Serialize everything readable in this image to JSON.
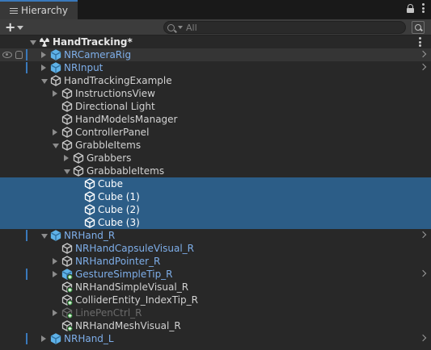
{
  "tab": {
    "title": "Hierarchy"
  },
  "search": {
    "placeholder": "All"
  },
  "rows": [
    {
      "name": "HandTracking*",
      "kind": "scene",
      "depth": 0,
      "fold": "down"
    },
    {
      "name": "NRCameraRig",
      "kind": "prefab",
      "depth": 1,
      "fold": "right",
      "style": "blue",
      "chevron": true,
      "modified": true,
      "hovered": true,
      "tools": true
    },
    {
      "name": "NRInput",
      "kind": "prefab",
      "depth": 1,
      "fold": "right",
      "style": "blue",
      "chevron": true,
      "modified": true
    },
    {
      "name": "HandTrackingExample",
      "kind": "object",
      "depth": 1,
      "fold": "down",
      "style": "grey"
    },
    {
      "name": "InstructionsView",
      "kind": "object",
      "depth": 2,
      "fold": "right",
      "style": "grey"
    },
    {
      "name": "Directional Light",
      "kind": "object",
      "depth": 2,
      "fold": "none",
      "style": "grey"
    },
    {
      "name": "HandModelsManager",
      "kind": "object",
      "depth": 2,
      "fold": "none",
      "style": "grey"
    },
    {
      "name": "ControllerPanel",
      "kind": "object",
      "depth": 2,
      "fold": "right",
      "style": "grey"
    },
    {
      "name": "GrabbleItems",
      "kind": "object",
      "depth": 2,
      "fold": "down",
      "style": "grey"
    },
    {
      "name": "Grabbers",
      "kind": "object",
      "depth": 3,
      "fold": "right",
      "style": "grey"
    },
    {
      "name": "GrabbableItems",
      "kind": "object",
      "depth": 3,
      "fold": "down",
      "style": "grey"
    },
    {
      "name": "Cube",
      "kind": "object",
      "depth": 4,
      "fold": "none",
      "style": "white",
      "selected": true
    },
    {
      "name": "Cube (1)",
      "kind": "object",
      "depth": 4,
      "fold": "none",
      "style": "white",
      "selected": true
    },
    {
      "name": "Cube (2)",
      "kind": "object",
      "depth": 4,
      "fold": "none",
      "style": "white",
      "selected": true
    },
    {
      "name": "Cube (3)",
      "kind": "object",
      "depth": 4,
      "fold": "none",
      "style": "white",
      "selected": true
    },
    {
      "name": "NRHand_R",
      "kind": "prefab",
      "depth": 1,
      "fold": "down",
      "style": "blue",
      "chevron": true,
      "modified": true
    },
    {
      "name": "NRHandCapsuleVisual_R",
      "kind": "object",
      "depth": 2,
      "fold": "none",
      "style": "blue"
    },
    {
      "name": "NRHandPointer_R",
      "kind": "object",
      "depth": 2,
      "fold": "right",
      "style": "blue"
    },
    {
      "name": "GestureSimpleTip_R",
      "kind": "prefab-added",
      "depth": 2,
      "fold": "right",
      "style": "blue",
      "chevron": true,
      "modified": true
    },
    {
      "name": "NRHandSimpleVisual_R",
      "kind": "object-added",
      "depth": 2,
      "fold": "none",
      "style": "grey"
    },
    {
      "name": "ColliderEntity_IndexTip_R",
      "kind": "object-added",
      "depth": 2,
      "fold": "none",
      "style": "grey"
    },
    {
      "name": "LinePenCtrl_R",
      "kind": "object-added",
      "depth": 2,
      "fold": "right",
      "style": "dim"
    },
    {
      "name": "NRHandMeshVisual_R",
      "kind": "object-added",
      "depth": 2,
      "fold": "none",
      "style": "grey"
    },
    {
      "name": "NRHand_L",
      "kind": "prefab",
      "depth": 1,
      "fold": "right",
      "style": "blue",
      "chevron": true,
      "modified": true
    }
  ]
}
